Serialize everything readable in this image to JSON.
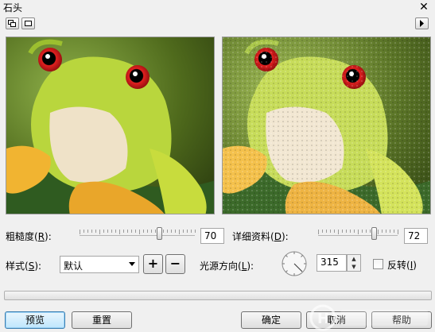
{
  "window": {
    "title": "石头",
    "close_glyph": "✕"
  },
  "toolbar": {
    "left_buttons": [
      "dual-preview-icon",
      "single-preview-icon"
    ],
    "right_button": "play-arrow-icon"
  },
  "controls": {
    "roughness": {
      "label": "粗糙度(",
      "key": "R",
      "suffix": "):",
      "value": "70",
      "fraction": 0.7
    },
    "detail": {
      "label": "详细资料(",
      "key": "D",
      "suffix": "):",
      "value": "72",
      "fraction": 0.72
    },
    "style": {
      "label": "样式(",
      "key": "S",
      "suffix": "):",
      "selected": "默认"
    },
    "plus_label": "+",
    "minus_label": "−",
    "light_direction": {
      "label": "光源方向(",
      "key": "L",
      "suffix": "):",
      "value": "315"
    },
    "invert": {
      "label": "反转(",
      "key": "I",
      "suffix": ")",
      "checked": false
    }
  },
  "buttons": {
    "preview": "预览",
    "reset": "重置",
    "ok": "确定",
    "cancel": "取消",
    "help": "帮助"
  },
  "colors": {
    "accent_border": "#3c7fb1",
    "frog_green": "#b5d33a",
    "frog_eye_red": "#d81a1a"
  }
}
